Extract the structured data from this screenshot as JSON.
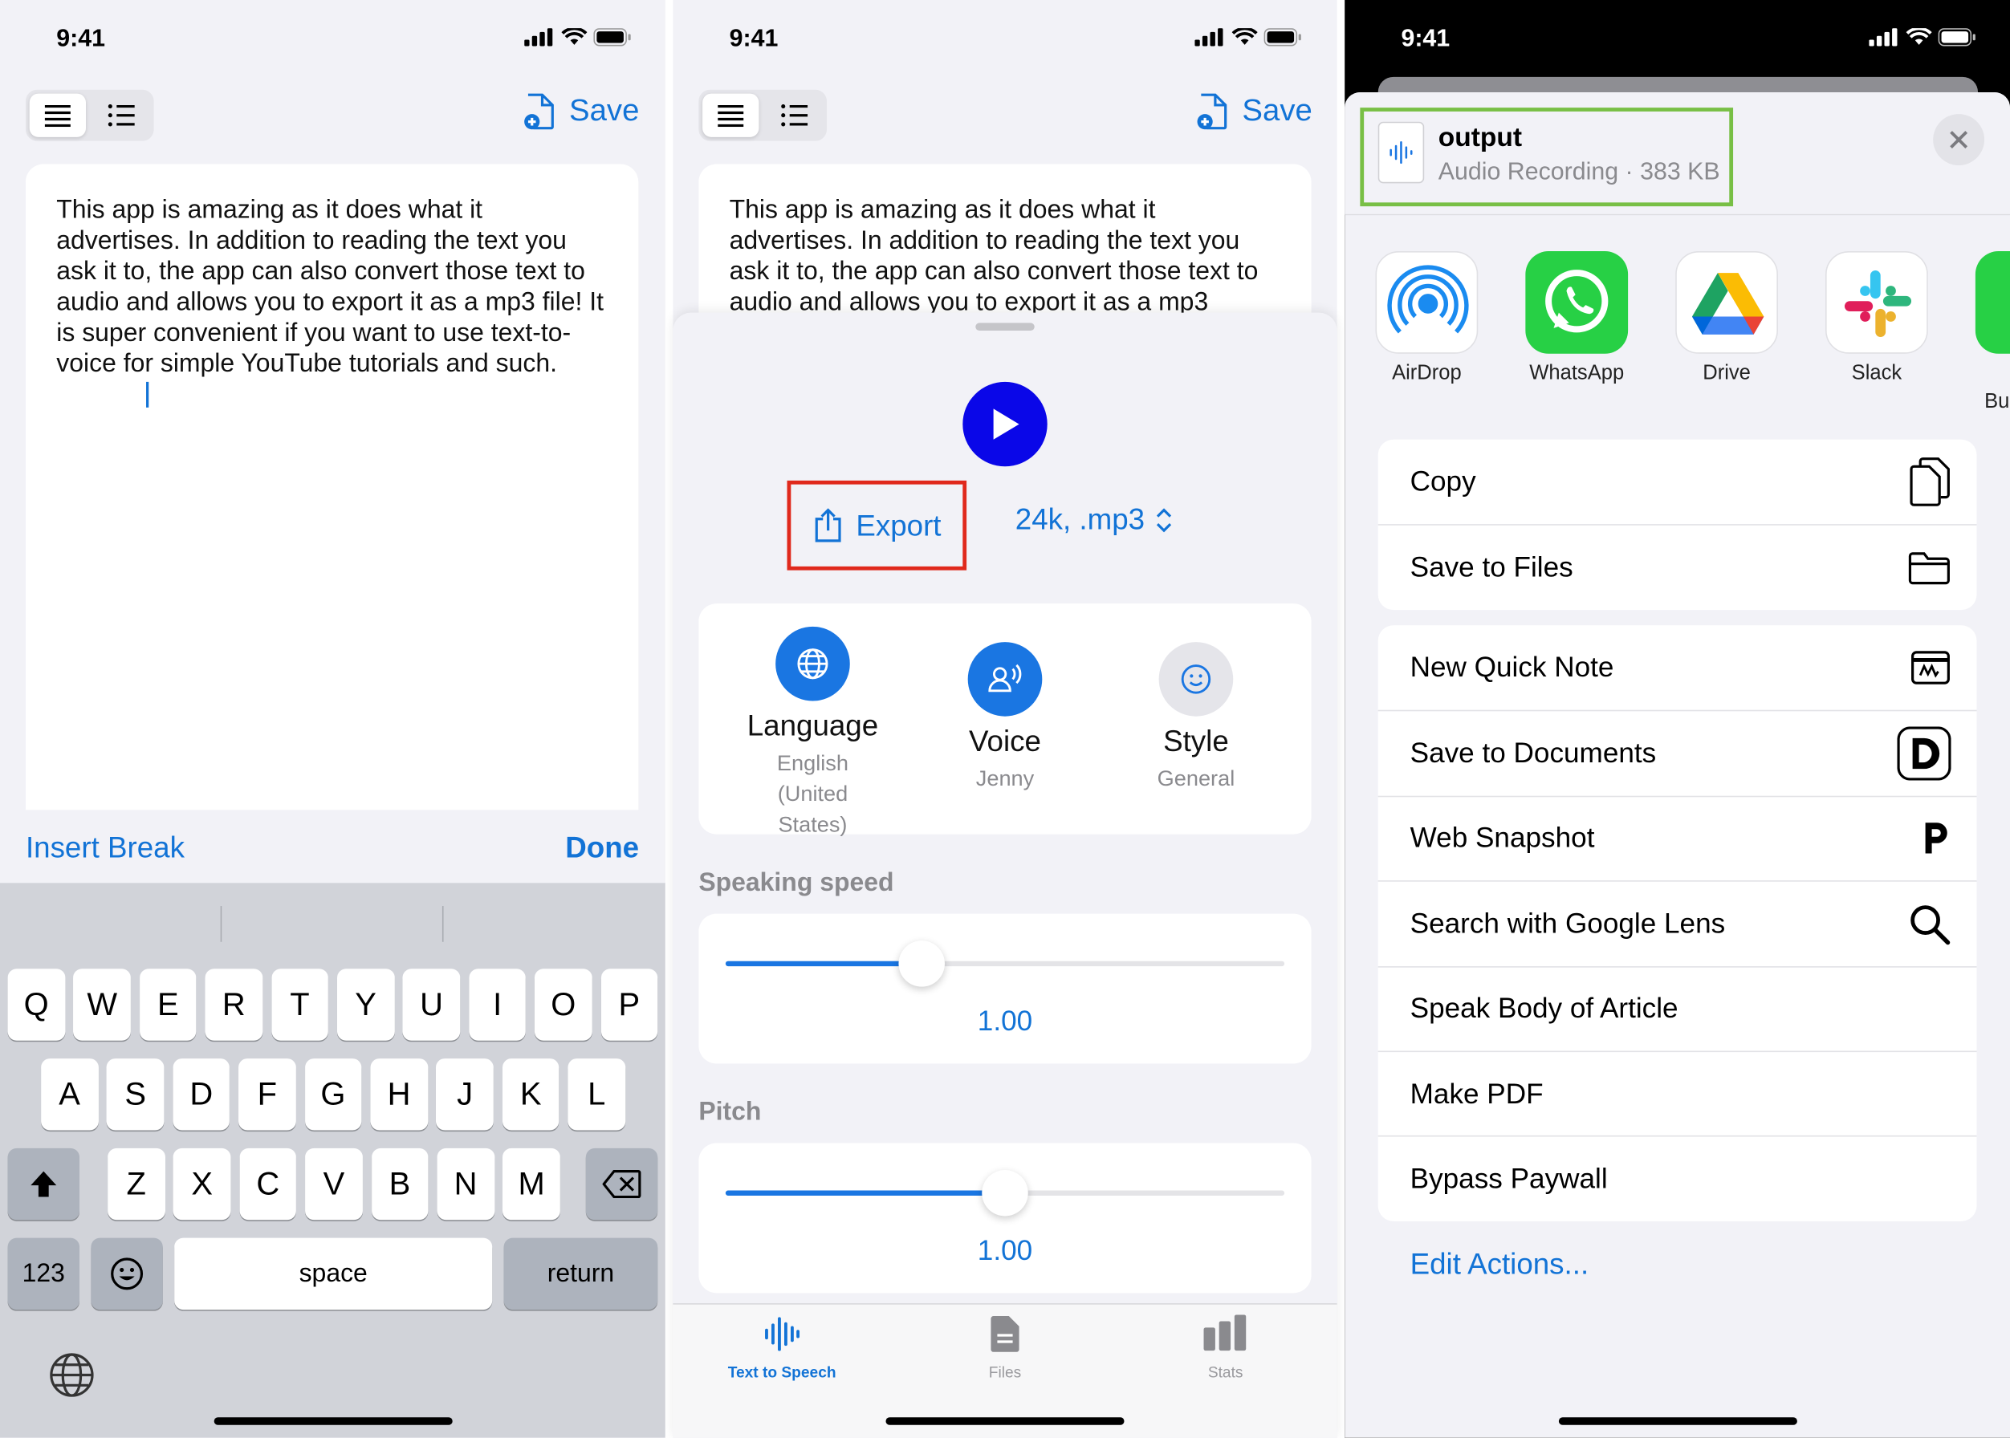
{
  "status": {
    "time": "9:41"
  },
  "editor": {
    "save_label": "Save",
    "text": "This app is amazing as it does what it advertises. In addition to reading the text you ask it to, the app can also convert those text to audio and allows you to export it as a mp3 file! It is super convenient if you want to use text-to-voice for simple YouTube tutorials and such.",
    "text_cut": "This app is amazing as it does what it advertises. In addition to reading the text you ask it to, the app can also convert those text to audio and allows you to export it as a mp3"
  },
  "keyboard": {
    "insert_break": "Insert Break",
    "done": "Done",
    "row1": [
      "Q",
      "W",
      "E",
      "R",
      "T",
      "Y",
      "U",
      "I",
      "O",
      "P"
    ],
    "row2": [
      "A",
      "S",
      "D",
      "F",
      "G",
      "H",
      "J",
      "K",
      "L"
    ],
    "row3": [
      "Z",
      "X",
      "C",
      "V",
      "B",
      "N",
      "M"
    ],
    "numbers": "123",
    "space": "space",
    "return": "return"
  },
  "player": {
    "export_label": "Export",
    "format_label": "24k, .mp3",
    "options": [
      {
        "title": "Language",
        "sub": "English (United States)"
      },
      {
        "title": "Voice",
        "sub": "Jenny"
      },
      {
        "title": "Style",
        "sub": "General"
      }
    ],
    "speed_label": "Speaking speed",
    "speed_value": "1.00",
    "speed_fraction": 0.35,
    "pitch_label": "Pitch",
    "pitch_value": "1.00",
    "pitch_fraction": 0.5
  },
  "tabs": [
    {
      "label": "Text to Speech",
      "active": true
    },
    {
      "label": "Files",
      "active": false
    },
    {
      "label": "Stats",
      "active": false
    }
  ],
  "share": {
    "file_name": "output",
    "file_meta": "Audio Recording · 383 KB",
    "apps": [
      "AirDrop",
      "WhatsApp",
      "Drive",
      "Slack",
      "Bu"
    ],
    "actions_group1": [
      "Copy",
      "Save to Files"
    ],
    "actions_group2": [
      "New Quick Note",
      "Save to Documents",
      "Web Snapshot",
      "Search with Google Lens",
      "Speak Body of Article",
      "Make PDF",
      "Bypass Paywall"
    ],
    "edit_actions": "Edit Actions..."
  },
  "colors": {
    "accent": "#1273d6",
    "play": "#0a07e8",
    "export_highlight": "#e0291c",
    "file_highlight": "#78bf45"
  }
}
